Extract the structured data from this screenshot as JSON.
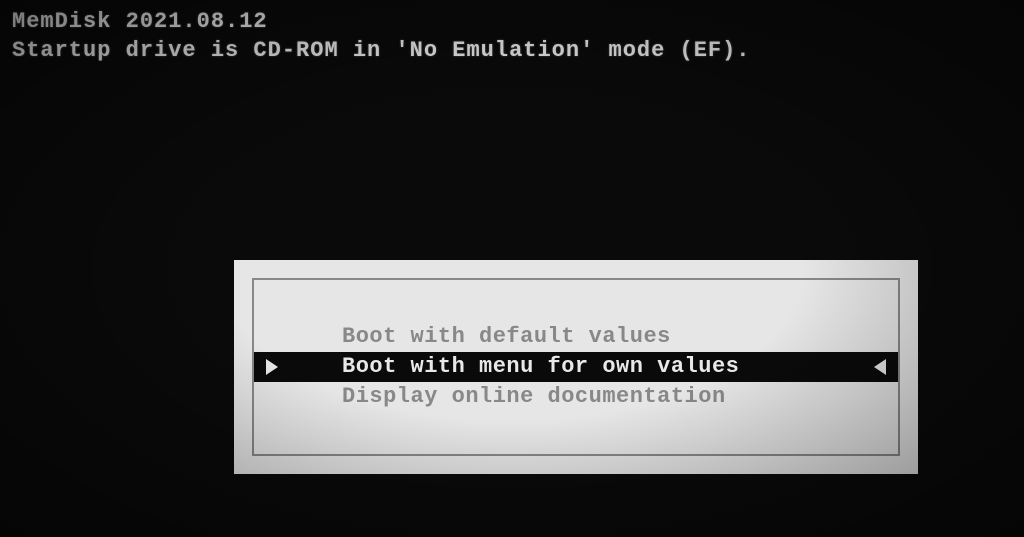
{
  "header": {
    "line1": "MemDisk 2021.08.12",
    "line2": "Startup drive is CD-ROM in 'No Emulation' mode (EF)."
  },
  "menu": {
    "items": [
      {
        "label": "Boot with default values",
        "selected": false
      },
      {
        "label": "Boot with menu for own values",
        "selected": true
      },
      {
        "label": "Display online documentation",
        "selected": false
      }
    ]
  }
}
